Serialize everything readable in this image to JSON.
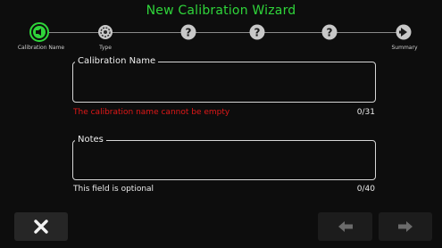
{
  "window": {
    "title": "New Calibration Wizard"
  },
  "steps": [
    {
      "label": "Calibration Name",
      "icon": "speaker-icon",
      "state": "active"
    },
    {
      "label": "Type",
      "icon": "gear-icon",
      "state": "inactive"
    },
    {
      "label": "",
      "icon": "question-icon",
      "state": "inactive"
    },
    {
      "label": "",
      "icon": "question-icon",
      "state": "inactive"
    },
    {
      "label": "",
      "icon": "question-icon",
      "state": "inactive"
    },
    {
      "label": "Summary",
      "icon": "arrow-right-circle-icon",
      "state": "inactive"
    }
  ],
  "calibration_name": {
    "label": "Calibration Name",
    "value": "",
    "error": "The calibration name cannot be empty",
    "counter": "0/31"
  },
  "notes": {
    "label": "Notes",
    "value": "",
    "hint": "This field is optional",
    "counter": "0/40"
  },
  "buttons": {
    "cancel_icon": "close-icon",
    "back_icon": "arrow-left-icon",
    "next_icon": "arrow-right-icon"
  },
  "colors": {
    "title": "#2fd53a",
    "active_step": "#2fd53a",
    "error": "#e01818",
    "inactive_step": "#c8c8c8"
  }
}
